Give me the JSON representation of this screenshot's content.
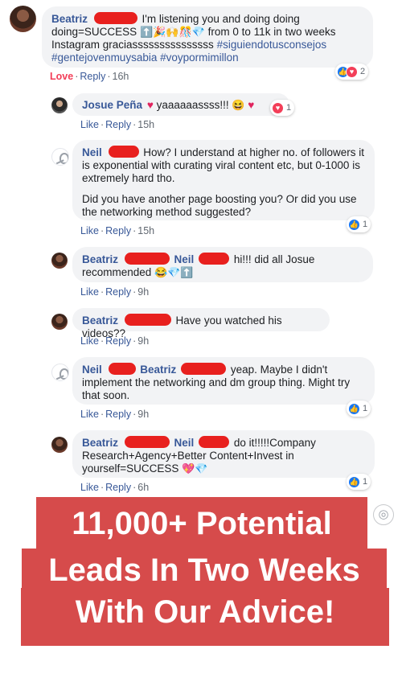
{
  "comments": [
    {
      "author": "Beatriz",
      "text_1": "I'm listening you and doing doing",
      "text_2": "doing=SUCCESS",
      "text_3": "from 0 to 11k in two weeks",
      "text_4": "Instagram graciasssssssssssssss",
      "hashtags_1": "#siguiendotusconsejos",
      "hashtags_2": "#gentejovenmuysabia #voypormimillon",
      "love": "Love",
      "reply": "Reply",
      "time": "16h",
      "reaction_count": "2"
    },
    {
      "author": "Josue Peña",
      "text": "yaaaaaassss!!!",
      "like": "Like",
      "reply": "Reply",
      "time": "15h",
      "reaction_count": "1"
    },
    {
      "author": "Neil",
      "text_1": "How? I understand at higher no. of followers it is exponential with curating viral content etc, but 0-1000 is extremely hard tho.",
      "text_2": "Did you have another page boosting you? Or did you use the networking method suggested?",
      "like": "Like",
      "reply": "Reply",
      "time": "15h",
      "reaction_count": "1"
    },
    {
      "author": "Beatriz",
      "mention": "Neil",
      "text": "hi!!! did all Josue recommended",
      "like": "Like",
      "reply": "Reply",
      "time": "9h"
    },
    {
      "author": "Beatriz",
      "text": "Have you watched his videos??",
      "like": "Like",
      "reply": "Reply",
      "time": "9h"
    },
    {
      "author": "Neil",
      "mention": "Beatriz",
      "text": "yeap. Maybe I didn't implement the networking and dm group thing. Might try that soon.",
      "like": "Like",
      "reply": "Reply",
      "time": "9h",
      "reaction_count": "1"
    },
    {
      "author": "Beatriz",
      "mention": "Neil",
      "text": "do it!!!!!Company Research+Agency+Better Content+Invest in yourself=SUCCESS",
      "like": "Like",
      "reply": "Reply",
      "time": "6h",
      "reaction_count": "1"
    }
  ],
  "banner": {
    "line_1": "11,000+ Potential",
    "line_2": "Leads In Two Weeks",
    "line_3": "With Our Advice!"
  },
  "colors": {
    "banner_red": "#d64b4b",
    "link_blue": "#385898",
    "redaction_red": "#e8201e"
  },
  "icons": [
    "like-icon",
    "love-icon",
    "camera-icon",
    "top-arrow-emoji"
  ]
}
